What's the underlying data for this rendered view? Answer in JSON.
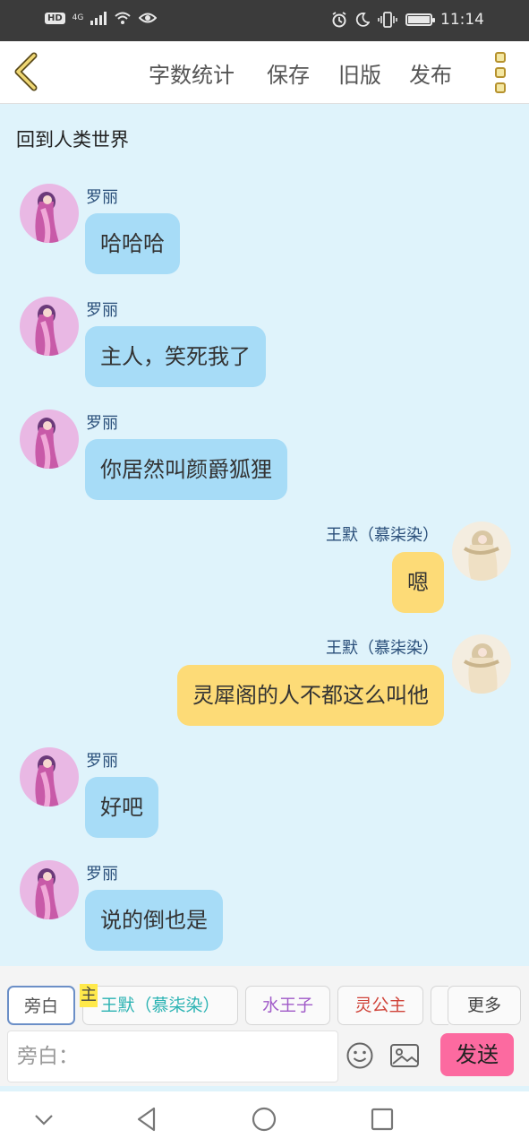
{
  "status_bar": {
    "network": "4G",
    "hd_badge": "HD",
    "time": "11:14"
  },
  "toolbar": {
    "word_count": "字数统计",
    "save": "保存",
    "old_version": "旧版",
    "publish": "发布"
  },
  "chat": {
    "title": "回到人类世界",
    "messages": [
      {
        "sender": "罗丽",
        "text": "哈哈哈",
        "side": "left"
      },
      {
        "sender": "罗丽",
        "text": "主人，笑死我了",
        "side": "left"
      },
      {
        "sender": "罗丽",
        "text": "你居然叫颜爵狐狸",
        "side": "left"
      },
      {
        "sender": "王默（慕柒染）",
        "text": "嗯",
        "side": "right"
      },
      {
        "sender": "王默（慕柒染）",
        "text": "灵犀阁的人不都这么叫他",
        "side": "right"
      },
      {
        "sender": "罗丽",
        "text": "好吧",
        "side": "left"
      },
      {
        "sender": "罗丽",
        "text": "说的倒也是",
        "side": "left"
      }
    ]
  },
  "characters": {
    "main_tag": "主",
    "chips": [
      {
        "label": "旁白",
        "color": "#555555"
      },
      {
        "label": "王默（慕柒染）",
        "color": "#2bb3b3"
      },
      {
        "label": "水王子",
        "color": "#a05ac8"
      },
      {
        "label": "灵公主",
        "color": "#d0443a"
      }
    ],
    "more": "更多"
  },
  "input": {
    "placeholder": "旁白："
  },
  "send_label": "发送",
  "colors": {
    "left_bubble": "#a7dcf7",
    "right_bubble": "#fddb77",
    "send_button": "#fc6aa0",
    "chat_background": "#dff3fb"
  }
}
